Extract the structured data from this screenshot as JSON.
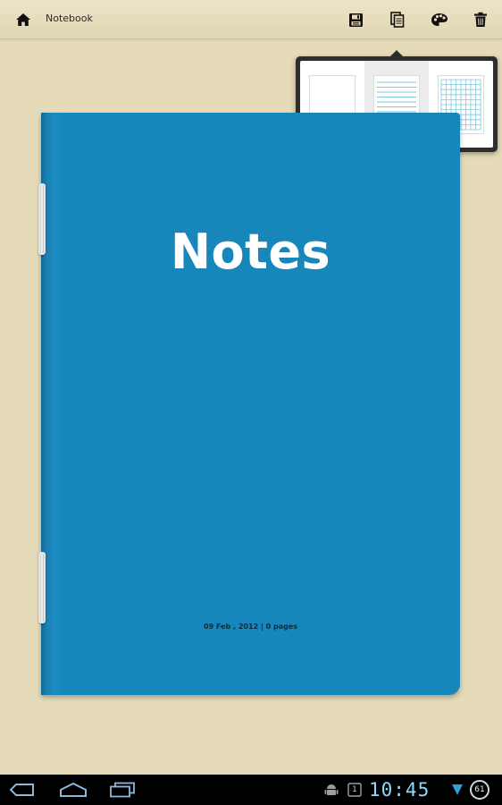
{
  "actionbar": {
    "title": "Notebook",
    "icons": {
      "home": "home-icon",
      "save": "floppy-disk-icon",
      "pages": "copy-pages-icon",
      "palette": "palette-icon",
      "delete": "trash-icon"
    }
  },
  "template_popup": {
    "templates": [
      {
        "name": "blank",
        "selected": false
      },
      {
        "name": "lined",
        "selected": true
      },
      {
        "name": "grid",
        "selected": false
      }
    ],
    "accent_line_color": "#7fc8dc"
  },
  "notebook": {
    "title": "Notes",
    "meta": "09 Feb , 2012 | 0 pages",
    "cover_color": "#1787bb"
  },
  "system_bar": {
    "clock": "10:45",
    "battery": "61",
    "notification_count": "1"
  }
}
